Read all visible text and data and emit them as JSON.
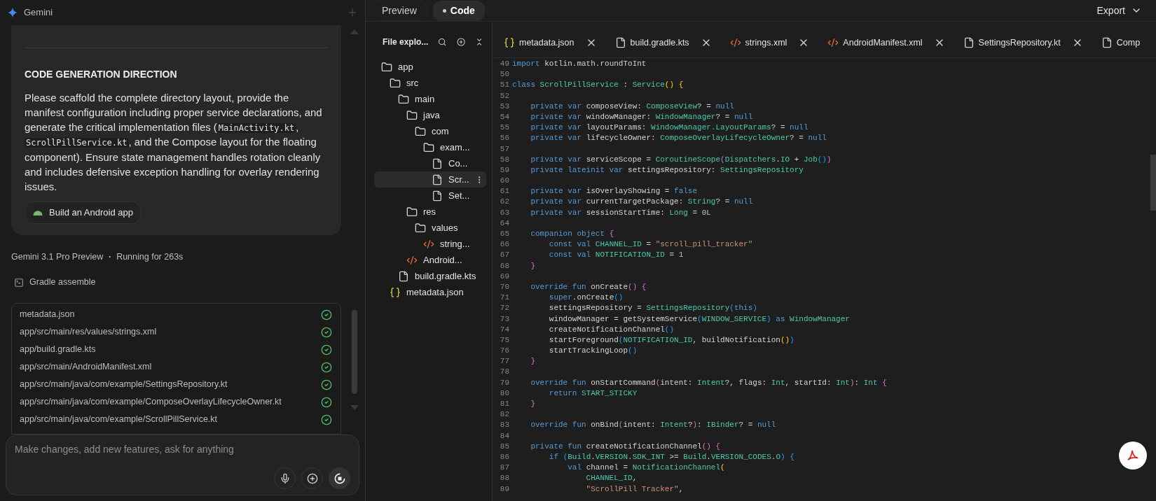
{
  "chat": {
    "app_title": "Gemini",
    "card": {
      "heading": "CODE GENERATION DIRECTION",
      "paragraph": [
        {
          "kind": "text",
          "text": "Please scaffold the complete directory layout, provide the manifest configuration including proper service declarations, and generate the critical implementation files ("
        },
        {
          "kind": "code",
          "text": "MainActivity.kt"
        },
        {
          "kind": "text",
          "text": ", "
        },
        {
          "kind": "code",
          "text": "ScrollPillService.kt"
        },
        {
          "kind": "text",
          "text": ", and the Compose layout for the floating component). Ensure state management handles rotation cleanly and includes defensive exception handling for overlay rendering issues."
        }
      ],
      "chip": "Build an Android app"
    },
    "model": "Gemini 3.1 Pro Preview",
    "separator": "•",
    "run_status": "Running for 263s",
    "task": "Gradle assemble",
    "files": [
      {
        "path": "metadata.json",
        "done": true
      },
      {
        "path": "app/src/main/res/values/strings.xml",
        "done": true
      },
      {
        "path": "app/build.gradle.kts",
        "done": true
      },
      {
        "path": "app/src/main/AndroidManifest.xml",
        "done": true
      },
      {
        "path": "app/src/main/java/com/example/SettingsRepository.kt",
        "done": true
      },
      {
        "path": "app/src/main/java/com/example/ComposeOverlayLifecycleOwner.kt",
        "done": true
      },
      {
        "path": "app/src/main/java/com/example/ScrollPillService.kt",
        "done": true
      }
    ],
    "input": {
      "placeholder": "Make changes, add new features, ask for anything"
    }
  },
  "view_tabs": [
    {
      "label": "Preview",
      "selected": false
    },
    {
      "label": "Code",
      "selected": true
    }
  ],
  "export": "Export",
  "explorer": {
    "title": "File explo...",
    "tree": [
      {
        "kind": "folder",
        "name": "app",
        "selected": false,
        "children": [
          {
            "kind": "folder",
            "name": "src",
            "selected": false,
            "children": [
              {
                "kind": "folder",
                "name": "main",
                "selected": false,
                "children": [
                  {
                    "kind": "folder",
                    "name": "java",
                    "selected": false,
                    "children": [
                      {
                        "kind": "folder",
                        "name": "com",
                        "selected": false,
                        "children": [
                          {
                            "kind": "folder",
                            "name": "exam...",
                            "selected": false,
                            "children": [
                              {
                                "kind": "file",
                                "name": "Co...",
                                "selected": false
                              },
                              {
                                "kind": "file",
                                "name": "Scr...",
                                "selected": true
                              },
                              {
                                "kind": "file",
                                "name": "Set...",
                                "selected": false
                              }
                            ]
                          }
                        ]
                      }
                    ]
                  },
                  {
                    "kind": "folder",
                    "name": "res",
                    "selected": false,
                    "children": [
                      {
                        "kind": "folder",
                        "name": "values",
                        "selected": false,
                        "children": [
                          {
                            "kind": "xml",
                            "name": "string...",
                            "selected": false
                          }
                        ]
                      }
                    ]
                  },
                  {
                    "kind": "xml",
                    "name": "Android...",
                    "selected": false
                  }
                ]
              },
              {
                "kind": "file",
                "name": "build.gradle.kts",
                "selected": false
              }
            ]
          },
          {
            "kind": "json",
            "name": "metadata.json",
            "selected": false
          }
        ]
      }
    ]
  },
  "editor_tabs": [
    {
      "kind": "json",
      "label": "metadata.json"
    },
    {
      "kind": "file",
      "label": "build.gradle.kts"
    },
    {
      "kind": "xml",
      "label": "strings.xml"
    },
    {
      "kind": "xml",
      "label": "AndroidManifest.xml"
    },
    {
      "kind": "file",
      "label": "SettingsRepository.kt"
    },
    {
      "kind": "file",
      "label": "Comp"
    }
  ],
  "code": [
    {
      "number": "49",
      "tokens": [
        {
          "kind": "kw",
          "text": "import"
        },
        {
          "kind": "id",
          "text": " kotlin.math.roundToInt"
        }
      ]
    },
    {
      "number": "50"
    },
    {
      "number": "51",
      "tokens": [
        {
          "kind": "kw",
          "text": "class "
        },
        {
          "kind": "type",
          "text": "ScrollPillService"
        },
        {
          "kind": "id",
          "text": " : "
        },
        {
          "kind": "type",
          "text": "Service"
        },
        {
          "kind": "b1",
          "text": "() {"
        }
      ]
    },
    {
      "number": "52"
    },
    {
      "number": "53",
      "tokens": [
        {
          "kind": "kw",
          "text": "    private var"
        },
        {
          "kind": "id",
          "text": " composeView: "
        },
        {
          "kind": "type",
          "text": "ComposeView"
        },
        {
          "kind": "id",
          "text": "? = "
        },
        {
          "kind": "kw",
          "text": "null"
        }
      ]
    },
    {
      "number": "54",
      "tokens": [
        {
          "kind": "kw",
          "text": "    private var"
        },
        {
          "kind": "id",
          "text": " windowManager: "
        },
        {
          "kind": "type",
          "text": "WindowManager"
        },
        {
          "kind": "id",
          "text": "? = "
        },
        {
          "kind": "kw",
          "text": "null"
        }
      ]
    },
    {
      "number": "55",
      "tokens": [
        {
          "kind": "kw",
          "text": "    private var"
        },
        {
          "kind": "id",
          "text": " layoutParams: "
        },
        {
          "kind": "type",
          "text": "WindowManager.LayoutParams"
        },
        {
          "kind": "id",
          "text": "? = "
        },
        {
          "kind": "kw",
          "text": "null"
        }
      ]
    },
    {
      "number": "56",
      "tokens": [
        {
          "kind": "kw",
          "text": "    private var"
        },
        {
          "kind": "id",
          "text": " lifecycleOwner: "
        },
        {
          "kind": "type",
          "text": "ComposeOverlayLifecycleOwner"
        },
        {
          "kind": "id",
          "text": "? = "
        },
        {
          "kind": "kw",
          "text": "null"
        }
      ]
    },
    {
      "number": "57"
    },
    {
      "number": "58",
      "tokens": [
        {
          "kind": "kw",
          "text": "    private var"
        },
        {
          "kind": "id",
          "text": " serviceScope = "
        },
        {
          "kind": "type",
          "text": "CoroutineScope"
        },
        {
          "kind": "b2",
          "text": "("
        },
        {
          "kind": "type",
          "text": "Dispatchers"
        },
        {
          "kind": "id",
          "text": "."
        },
        {
          "kind": "type",
          "text": "IO"
        },
        {
          "kind": "id",
          "text": " + "
        },
        {
          "kind": "type",
          "text": "Job"
        },
        {
          "kind": "b3",
          "text": "()"
        },
        {
          "kind": "b2",
          "text": ")"
        }
      ]
    },
    {
      "number": "59",
      "tokens": [
        {
          "kind": "kw",
          "text": "    private lateinit var"
        },
        {
          "kind": "id",
          "text": " settingsRepository: "
        },
        {
          "kind": "type",
          "text": "SettingsRepository"
        }
      ]
    },
    {
      "number": "60"
    },
    {
      "number": "61",
      "tokens": [
        {
          "kind": "kw",
          "text": "    private var"
        },
        {
          "kind": "id",
          "text": " isOverlayShowing = "
        },
        {
          "kind": "kw",
          "text": "false"
        }
      ]
    },
    {
      "number": "62",
      "tokens": [
        {
          "kind": "kw",
          "text": "    private var"
        },
        {
          "kind": "id",
          "text": " currentTargetPackage: "
        },
        {
          "kind": "type",
          "text": "String"
        },
        {
          "kind": "id",
          "text": "? = "
        },
        {
          "kind": "kw",
          "text": "null"
        }
      ]
    },
    {
      "number": "63",
      "tokens": [
        {
          "kind": "kw",
          "text": "    private var"
        },
        {
          "kind": "id",
          "text": " sessionStartTime: "
        },
        {
          "kind": "type",
          "text": "Long"
        },
        {
          "kind": "id",
          "text": " = "
        },
        {
          "kind": "num",
          "text": "0L"
        }
      ]
    },
    {
      "number": "64"
    },
    {
      "number": "65",
      "tokens": [
        {
          "kind": "kw",
          "text": "    companion object"
        },
        {
          "kind": "b2",
          "text": " {"
        }
      ]
    },
    {
      "number": "66",
      "tokens": [
        {
          "kind": "kw",
          "text": "        const val "
        },
        {
          "kind": "type",
          "text": "CHANNEL_ID"
        },
        {
          "kind": "id",
          "text": " = "
        },
        {
          "kind": "str",
          "text": "\"scroll_pill_tracker\""
        }
      ]
    },
    {
      "number": "67",
      "tokens": [
        {
          "kind": "kw",
          "text": "        const val "
        },
        {
          "kind": "type",
          "text": "NOTIFICATION_ID"
        },
        {
          "kind": "id",
          "text": " = "
        },
        {
          "kind": "num",
          "text": "1"
        }
      ]
    },
    {
      "number": "68",
      "tokens": [
        {
          "kind": "b2",
          "text": "    }"
        }
      ]
    },
    {
      "number": "69"
    },
    {
      "number": "70",
      "tokens": [
        {
          "kind": "kw",
          "text": "    override fun"
        },
        {
          "kind": "id",
          "text": " onCreate"
        },
        {
          "kind": "b2",
          "text": "() {"
        }
      ]
    },
    {
      "number": "71",
      "tokens": [
        {
          "kind": "kw",
          "text": "        super"
        },
        {
          "kind": "id",
          "text": ".onCreate"
        },
        {
          "kind": "b3",
          "text": "()"
        }
      ]
    },
    {
      "number": "72",
      "tokens": [
        {
          "kind": "id",
          "text": "        settingsRepository = "
        },
        {
          "kind": "type",
          "text": "SettingsRepository"
        },
        {
          "kind": "b3",
          "text": "("
        },
        {
          "kind": "kw",
          "text": "this"
        },
        {
          "kind": "b3",
          "text": ")"
        }
      ]
    },
    {
      "number": "73",
      "tokens": [
        {
          "kind": "id",
          "text": "        windowManager = getSystemService"
        },
        {
          "kind": "b3",
          "text": "("
        },
        {
          "kind": "type",
          "text": "WINDOW_SERVICE"
        },
        {
          "kind": "b3",
          "text": ")"
        },
        {
          "kind": "kw",
          "text": " as "
        },
        {
          "kind": "type",
          "text": "WindowManager"
        }
      ]
    },
    {
      "number": "74",
      "tokens": [
        {
          "kind": "id",
          "text": "        createNotificationChannel"
        },
        {
          "kind": "b3",
          "text": "()"
        }
      ]
    },
    {
      "number": "75",
      "tokens": [
        {
          "kind": "id",
          "text": "        startForeground"
        },
        {
          "kind": "b3",
          "text": "("
        },
        {
          "kind": "type",
          "text": "NOTIFICATION_ID"
        },
        {
          "kind": "id",
          "text": ", buildNotification"
        },
        {
          "kind": "b1",
          "text": "()"
        },
        {
          "kind": "b3",
          "text": ")"
        }
      ]
    },
    {
      "number": "76",
      "tokens": [
        {
          "kind": "id",
          "text": "        startTrackingLoop"
        },
        {
          "kind": "b3",
          "text": "()"
        }
      ]
    },
    {
      "number": "77",
      "tokens": [
        {
          "kind": "b2",
          "text": "    }"
        }
      ]
    },
    {
      "number": "78"
    },
    {
      "number": "79",
      "tokens": [
        {
          "kind": "kw",
          "text": "    override fun"
        },
        {
          "kind": "id",
          "text": " onStartCommand"
        },
        {
          "kind": "b2",
          "text": "("
        },
        {
          "kind": "id",
          "text": "intent: "
        },
        {
          "kind": "type",
          "text": "Intent"
        },
        {
          "kind": "id",
          "text": "?, flags: "
        },
        {
          "kind": "type",
          "text": "Int"
        },
        {
          "kind": "id",
          "text": ", startId: "
        },
        {
          "kind": "type",
          "text": "Int"
        },
        {
          "kind": "b2",
          "text": ")"
        },
        {
          "kind": "id",
          "text": ": "
        },
        {
          "kind": "type",
          "text": "Int"
        },
        {
          "kind": "b2",
          "text": " {"
        }
      ]
    },
    {
      "number": "80",
      "tokens": [
        {
          "kind": "kw",
          "text": "        return "
        },
        {
          "kind": "type",
          "text": "START_STICKY"
        }
      ]
    },
    {
      "number": "81",
      "tokens": [
        {
          "kind": "b2",
          "text": "    }"
        }
      ]
    },
    {
      "number": "82"
    },
    {
      "number": "83",
      "tokens": [
        {
          "kind": "kw",
          "text": "    override fun"
        },
        {
          "kind": "id",
          "text": " onBind"
        },
        {
          "kind": "b2",
          "text": "("
        },
        {
          "kind": "id",
          "text": "intent: "
        },
        {
          "kind": "type",
          "text": "Intent"
        },
        {
          "kind": "id",
          "text": "?"
        },
        {
          "kind": "b2",
          "text": ")"
        },
        {
          "kind": "id",
          "text": ": "
        },
        {
          "kind": "type",
          "text": "IBinder"
        },
        {
          "kind": "id",
          "text": "? = "
        },
        {
          "kind": "kw",
          "text": "null"
        }
      ]
    },
    {
      "number": "84"
    },
    {
      "number": "85",
      "tokens": [
        {
          "kind": "kw",
          "text": "    private fun"
        },
        {
          "kind": "id",
          "text": " createNotificationChannel"
        },
        {
          "kind": "b2",
          "text": "() {"
        }
      ]
    },
    {
      "number": "86",
      "tokens": [
        {
          "kind": "kw",
          "text": "        if "
        },
        {
          "kind": "b3",
          "text": "("
        },
        {
          "kind": "type",
          "text": "Build"
        },
        {
          "kind": "id",
          "text": "."
        },
        {
          "kind": "type",
          "text": "VERSION"
        },
        {
          "kind": "id",
          "text": "."
        },
        {
          "kind": "type",
          "text": "SDK_INT"
        },
        {
          "kind": "id",
          "text": " >= "
        },
        {
          "kind": "type",
          "text": "Build"
        },
        {
          "kind": "id",
          "text": "."
        },
        {
          "kind": "type",
          "text": "VERSION_CODES"
        },
        {
          "kind": "id",
          "text": "."
        },
        {
          "kind": "type",
          "text": "O"
        },
        {
          "kind": "b3",
          "text": ") {"
        }
      ]
    },
    {
      "number": "87",
      "tokens": [
        {
          "kind": "kw",
          "text": "            val"
        },
        {
          "kind": "id",
          "text": " channel = "
        },
        {
          "kind": "type",
          "text": "NotificationChannel"
        },
        {
          "kind": "b1",
          "text": "("
        }
      ]
    },
    {
      "number": "88",
      "tokens": [
        {
          "kind": "type",
          "text": "                CHANNEL_ID"
        },
        {
          "kind": "id",
          "text": ","
        }
      ]
    },
    {
      "number": "89",
      "tokens": [
        {
          "kind": "str",
          "text": "                \"ScrollPill Tracker\""
        },
        {
          "kind": "id",
          "text": ","
        }
      ]
    }
  ]
}
